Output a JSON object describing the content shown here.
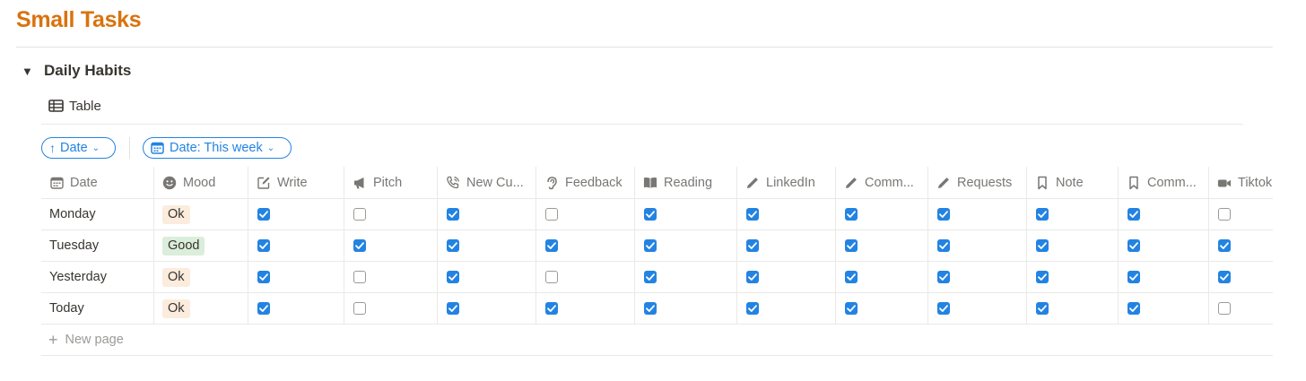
{
  "page": {
    "title": "Small Tasks",
    "title_color": "#d9730d"
  },
  "section": {
    "toggle_icon": "triangle-down-icon",
    "title": "Daily Habits"
  },
  "view": {
    "icon": "table-icon",
    "label": "Table"
  },
  "filters": {
    "sort": {
      "icon": "arrow-up-icon",
      "label": "Date"
    },
    "date_filter": {
      "icon": "calendar-icon",
      "label": "Date: This week"
    }
  },
  "accent": "#2383e2",
  "columns": [
    {
      "key": "date",
      "label": "Date",
      "icon": "calendar-icon"
    },
    {
      "key": "mood",
      "label": "Mood",
      "icon": "smiley-icon"
    },
    {
      "key": "write",
      "label": "Write",
      "icon": "compose-icon"
    },
    {
      "key": "pitch",
      "label": "Pitch",
      "icon": "megaphone-icon"
    },
    {
      "key": "new_customers",
      "label": "New Cu...",
      "icon": "phone-icon"
    },
    {
      "key": "feedback",
      "label": "Feedback",
      "icon": "ear-icon"
    },
    {
      "key": "reading",
      "label": "Reading",
      "icon": "book-icon"
    },
    {
      "key": "linkedin",
      "label": "LinkedIn",
      "icon": "pencil-icon"
    },
    {
      "key": "comm1",
      "label": "Comm...",
      "icon": "pencil-icon"
    },
    {
      "key": "requests",
      "label": "Requests",
      "icon": "pencil-icon"
    },
    {
      "key": "note",
      "label": "Note",
      "icon": "bookmark-icon"
    },
    {
      "key": "comm2",
      "label": "Comm...",
      "icon": "bookmark-icon"
    },
    {
      "key": "tiktok",
      "label": "Tiktok",
      "icon": "video-camera-icon"
    }
  ],
  "moods": {
    "Ok": {
      "bg": "#fbecdd",
      "color": "#37352f"
    },
    "Good": {
      "bg": "#dbeddb",
      "color": "#37352f"
    }
  },
  "rows": [
    {
      "date": "Monday",
      "mood": "Ok",
      "checks": [
        true,
        false,
        true,
        false,
        true,
        true,
        true,
        true,
        true,
        true,
        false
      ]
    },
    {
      "date": "Tuesday",
      "mood": "Good",
      "checks": [
        true,
        true,
        true,
        true,
        true,
        true,
        true,
        true,
        true,
        true,
        true
      ]
    },
    {
      "date": "Yesterday",
      "mood": "Ok",
      "checks": [
        true,
        false,
        true,
        false,
        true,
        true,
        true,
        true,
        true,
        true,
        true
      ]
    },
    {
      "date": "Today",
      "mood": "Ok",
      "checks": [
        true,
        false,
        true,
        true,
        true,
        true,
        true,
        true,
        true,
        true,
        false
      ]
    }
  ],
  "new_page": {
    "icon": "plus-icon",
    "label": "New page"
  }
}
